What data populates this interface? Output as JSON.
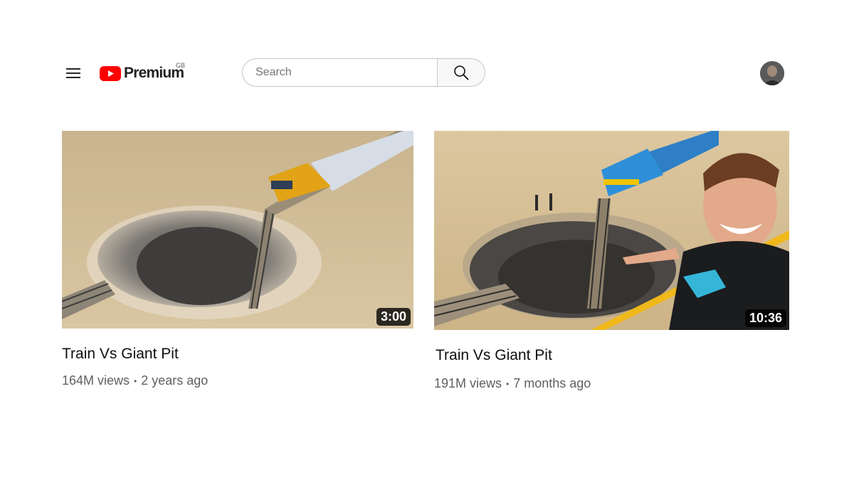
{
  "header": {
    "logo_text": "Premium",
    "region": "GB",
    "search_placeholder": "Search",
    "icons": [
      "menu-icon",
      "youtube-logo-icon",
      "search-icon",
      "avatar"
    ]
  },
  "videos": [
    {
      "title": "Train Vs Giant Pit",
      "duration": "3:00",
      "views": "164M views",
      "age": "2 years ago",
      "separator": "•"
    },
    {
      "title": "Train Vs Giant Pit",
      "duration": "10:36",
      "views": "191M views",
      "age": "7 months ago",
      "separator": "•"
    }
  ],
  "colors": {
    "brand_red": "#ff0000",
    "text_primary": "#0f0f0f",
    "text_secondary": "#606060",
    "border": "#c6c6c6"
  }
}
